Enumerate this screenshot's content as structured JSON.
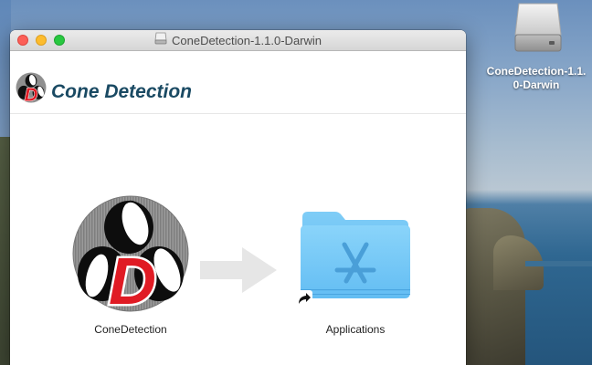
{
  "window": {
    "title": "ConeDetection-1.1.0-Darwin"
  },
  "installer": {
    "header_title": "Cone Detection",
    "app_label": "ConeDetection",
    "applications_label": "Applications"
  },
  "desktop": {
    "disk_label": "ConeDetection-1.1.\n0-Darwin"
  },
  "colors": {
    "header_title": "#1a4a63",
    "close": "#fc5f57",
    "minimize": "#fdbc2e",
    "zoom": "#28c840",
    "folder": "#63bdf3",
    "logo_red": "#e01b24"
  },
  "icons": [
    "disk-icon",
    "cone-detection-logo-icon",
    "arrow-right-icon",
    "applications-folder-icon",
    "alias-arrow-icon",
    "window-disk-icon"
  ]
}
